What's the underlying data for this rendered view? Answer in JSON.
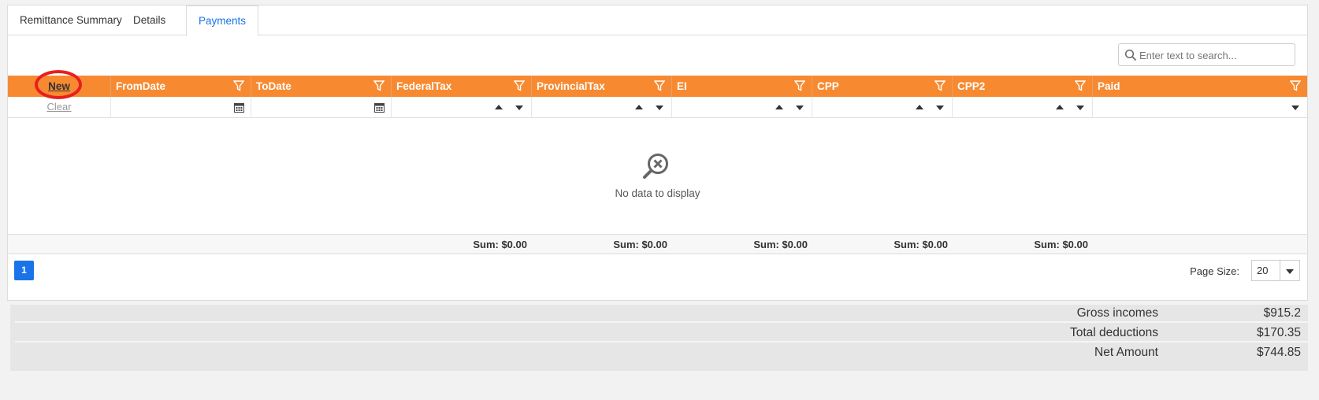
{
  "tabs": [
    {
      "label": "Remittance Summary",
      "active": false
    },
    {
      "label": "Details",
      "active": false
    },
    {
      "label": "Payments",
      "active": true
    }
  ],
  "search": {
    "placeholder": "Enter text to search..."
  },
  "grid": {
    "new_label": "New",
    "clear_label": "Clear",
    "columns": [
      "FromDate",
      "ToDate",
      "FederalTax",
      "ProvincialTax",
      "EI",
      "CPP",
      "CPP2",
      "Paid"
    ],
    "empty_text": "No data to display",
    "sums": [
      "Sum: $0.00",
      "Sum: $0.00",
      "Sum: $0.00",
      "Sum: $0.00",
      "Sum: $0.00"
    ],
    "header_color": "#f78a31"
  },
  "pager": {
    "current_page": "1",
    "page_size_label": "Page Size:",
    "page_size": "20",
    "accent": "#1a73e8"
  },
  "totals": [
    {
      "label": "Gross incomes",
      "value": "$915.2"
    },
    {
      "label": "Total deductions",
      "value": "$170.35"
    },
    {
      "label": "Net Amount",
      "value": "$744.85"
    }
  ]
}
